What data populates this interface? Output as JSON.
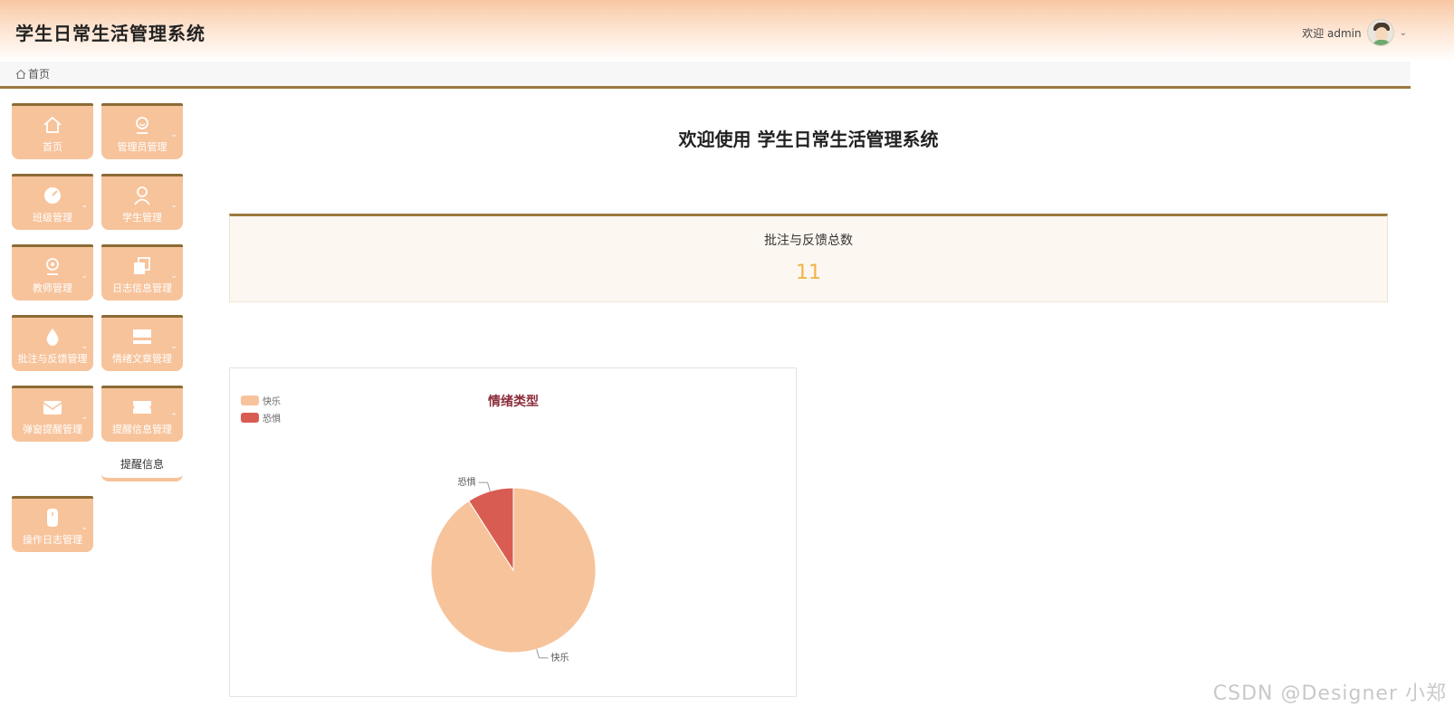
{
  "header": {
    "app_title": "学生日常生活管理系统",
    "welcome_user": "欢迎 admin"
  },
  "breadcrumb": {
    "home": "首页"
  },
  "nav": {
    "items": [
      {
        "label": "首页",
        "icon": "home-icon",
        "has_chevron": false
      },
      {
        "label": "管理员管理",
        "icon": "admin-icon",
        "has_chevron": true
      },
      {
        "label": "班级管理",
        "icon": "gauge-icon",
        "has_chevron": true
      },
      {
        "label": "学生管理",
        "icon": "student-icon",
        "has_chevron": true
      },
      {
        "label": "教师管理",
        "icon": "teacher-icon",
        "has_chevron": true
      },
      {
        "label": "日志信息管理",
        "icon": "copy-icon",
        "has_chevron": true
      },
      {
        "label": "批注与反馈管理",
        "icon": "drop-icon",
        "has_chevron": true
      },
      {
        "label": "情绪文章管理",
        "icon": "article-icon",
        "has_chevron": true
      },
      {
        "label": "弹窗提醒管理",
        "icon": "mail-icon",
        "has_chevron": true
      },
      {
        "label": "提醒信息管理",
        "icon": "ticket-icon",
        "has_chevron": true,
        "expanded": true
      },
      {
        "label": "操作日志管理",
        "icon": "log-icon",
        "has_chevron": true
      }
    ],
    "submenu": {
      "label": "提醒信息"
    }
  },
  "main": {
    "welcome": "欢迎使用 学生日常生活管理系统",
    "stat": {
      "label": "批注与反馈总数",
      "value": "11"
    }
  },
  "chart_data": {
    "type": "pie",
    "title": "情绪类型",
    "slices": [
      {
        "name": "快乐",
        "value": 10,
        "color": "#f7c39b"
      },
      {
        "name": "恐惧",
        "value": 1,
        "color": "#d95c52"
      }
    ],
    "legend": "top-left"
  },
  "watermark": "CSDN @Designer 小郑",
  "colors": {
    "accent": "#9b7a3e",
    "tile": "#f7c39b",
    "stat_value": "#f0b446",
    "chart_title": "#8b2d3b"
  }
}
